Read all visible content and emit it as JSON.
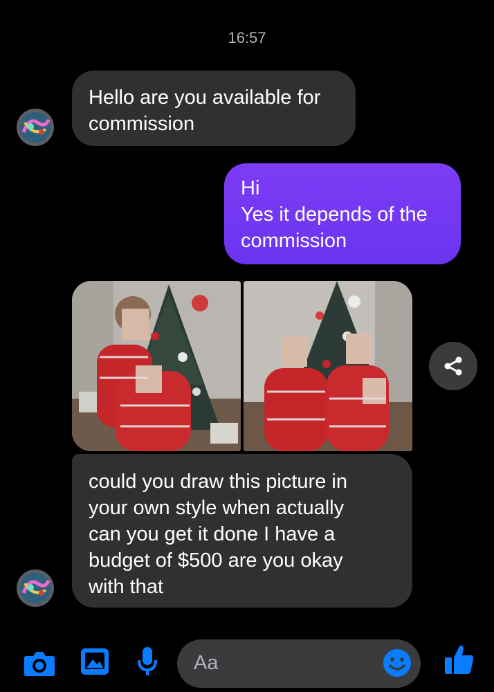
{
  "timestamp": "16:57",
  "messages": [
    {
      "direction": "incoming",
      "text": "Hello are you available for\ncommission"
    },
    {
      "direction": "outgoing",
      "text": "Hi\nYes it depends of the\ncommission"
    },
    {
      "direction": "incoming",
      "text": "could you draw this picture in\nyour own style when actually\ncan you get it done I have a\nbudget of $500 are you okay\nwith that"
    }
  ],
  "photos": [
    {
      "icon": "family-christmas-photo-1"
    },
    {
      "icon": "family-christmas-photo-2"
    }
  ],
  "composer": {
    "placeholder": "Aa",
    "icons": [
      "camera-icon",
      "gallery-icon",
      "microphone-icon",
      "emoji-icon",
      "thumbs-up-icon"
    ]
  },
  "colors": {
    "background": "#000000",
    "incoming_bubble": "#303030",
    "outgoing_bubble": "#7339f3",
    "accent": "#0a7cff"
  }
}
